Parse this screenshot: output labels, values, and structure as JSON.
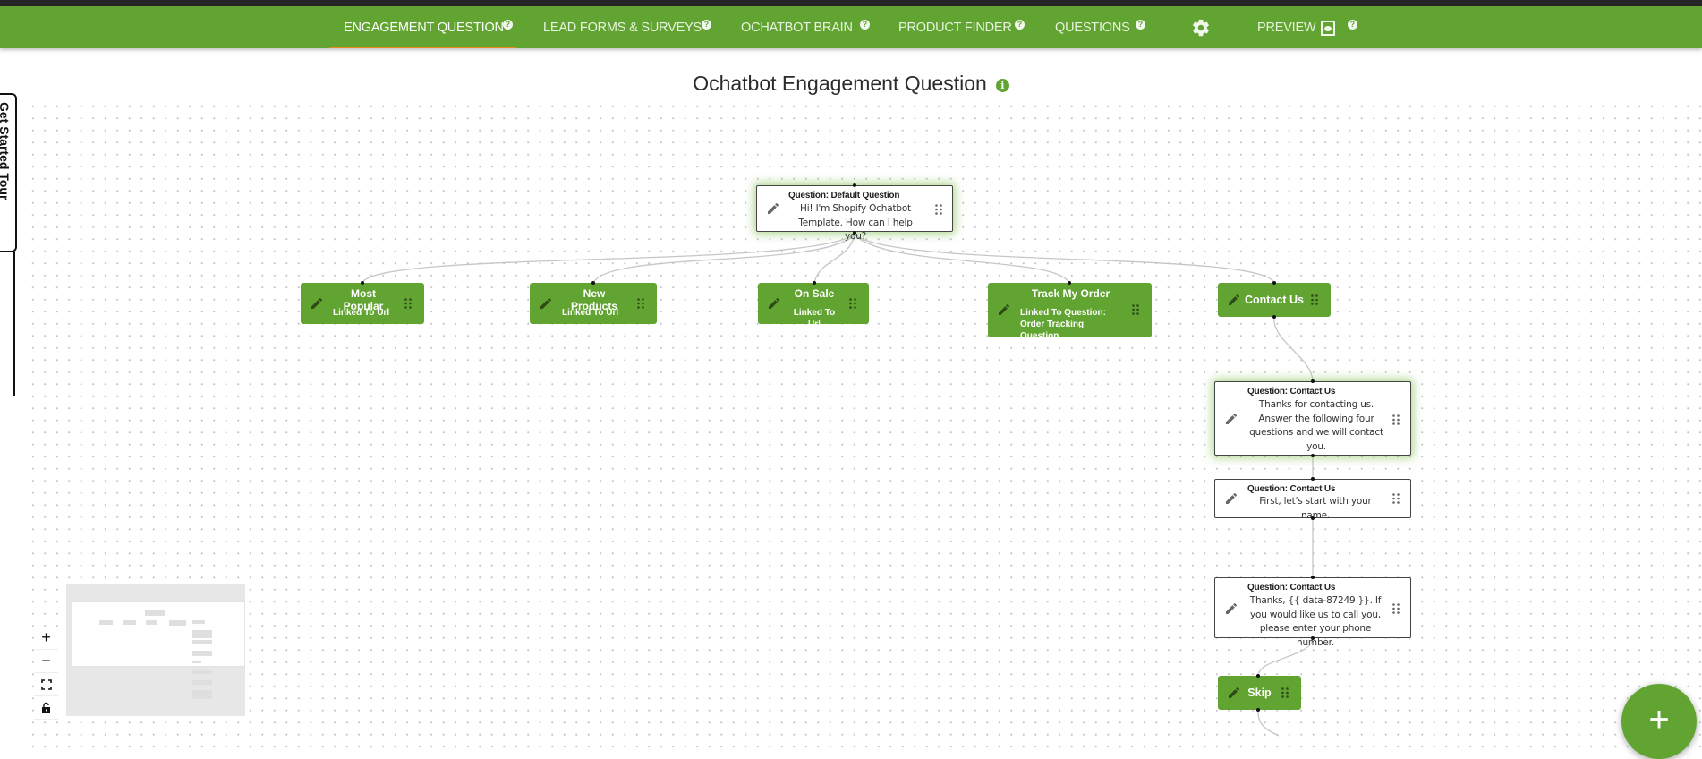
{
  "nav": {
    "tabs": [
      {
        "label": "ENGAGEMENT QUESTION",
        "active": true,
        "help": "?"
      },
      {
        "label": "LEAD FORMS & SURVEYS",
        "active": false,
        "help": "?"
      },
      {
        "label": "OCHATBOT BRAIN",
        "active": false,
        "help": "?"
      },
      {
        "label": "PRODUCT FINDER",
        "active": false,
        "help": "?"
      },
      {
        "label": "QUESTIONS",
        "active": false,
        "help": "?"
      }
    ],
    "settings_icon": "gear-icon",
    "preview": {
      "label": "PREVIEW",
      "icon": "eye-icon",
      "help": "?"
    }
  },
  "page": {
    "title": "Ochatbot Engagement Question",
    "info_icon": "i"
  },
  "tour": {
    "label": "Get Started Tour"
  },
  "flow": {
    "root": {
      "label": "Question: Default Question",
      "text": "Hi! I'm Shopify Ochatbot Template. How can I help you?"
    },
    "answers": [
      {
        "title": "Most Popular",
        "sub": "Linked To Url"
      },
      {
        "title": "New Products",
        "sub": "Linked To Url"
      },
      {
        "title": "On Sale",
        "sub": "Linked To Url"
      },
      {
        "title": "Track My Order",
        "sub": "Linked To Question: Order Tracking Question"
      },
      {
        "title": "Contact Us"
      }
    ],
    "contact_questions": [
      {
        "label": "Question: Contact Us",
        "text": "Thanks for contacting us. Answer the following four questions and we will contact you."
      },
      {
        "label": "Question: Contact Us",
        "text": "First, let's start with your name."
      },
      {
        "label": "Question: Contact Us",
        "text": "Thanks, {{ data-87249 }}. If you would like us to call you, please enter your phone number."
      }
    ],
    "skip": {
      "title": "Skip"
    }
  },
  "zoom_controls": {
    "zoom_in": "+",
    "zoom_out": "−",
    "fit": "fit-view-icon",
    "lock": "lock-icon"
  },
  "fab": {
    "label": "+"
  },
  "colors": {
    "brand_green": "#62a431",
    "active_tab_underline": "#e8881c",
    "top_strip": "#262626"
  }
}
